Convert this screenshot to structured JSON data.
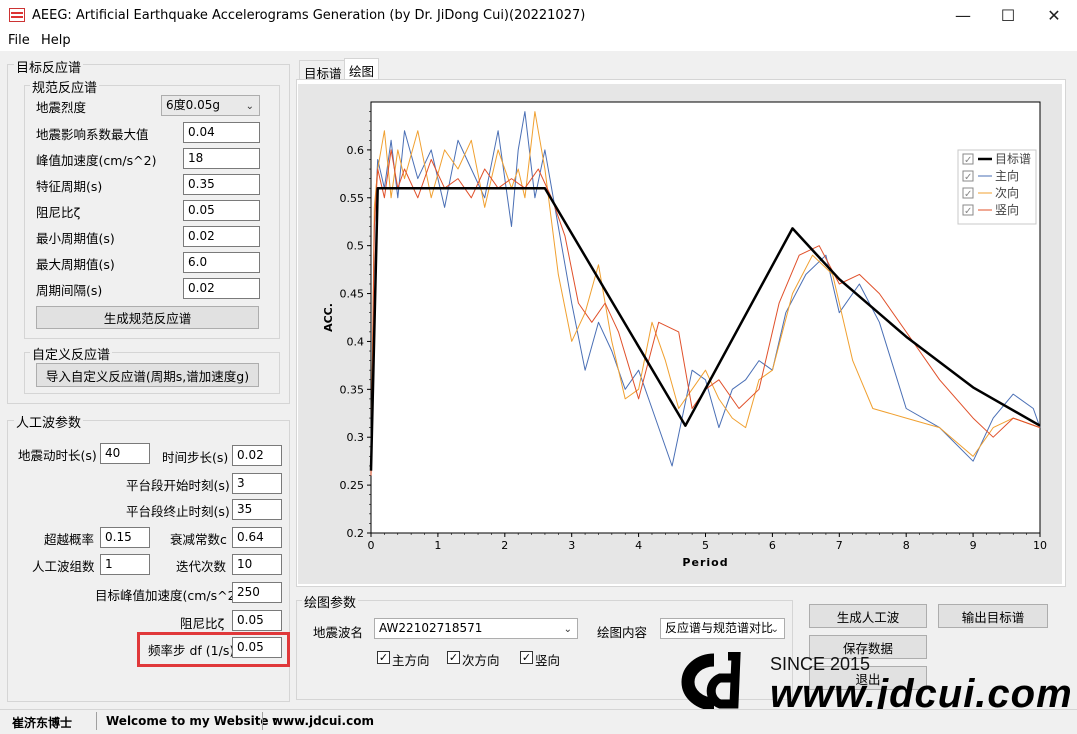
{
  "window": {
    "title": "AEEG: Artificial Earthquake Accelerograms Generation (by Dr. JiDong Cui)(20221027)",
    "minimize": "—",
    "maximize": "☐",
    "close": "✕"
  },
  "menu": {
    "file": "File",
    "help": "Help"
  },
  "target_spectrum": {
    "group_label": "目标反应谱",
    "code_group_label": "规范反应谱",
    "intensity_label": "地震烈度",
    "intensity_value": "6度0.05g",
    "alpha_max_label": "地震影响系数最大值",
    "alpha_max_value": "0.04",
    "pga_label": "峰值加速度(cm/s^2)",
    "pga_value": "18",
    "tg_label": "特征周期(s)",
    "tg_value": "0.35",
    "damping_label": "阻尼比ζ",
    "damping_value": "0.05",
    "tmin_label": "最小周期值(s)",
    "tmin_value": "0.02",
    "tmax_label": "最大周期值(s)",
    "tmax_value": "6.0",
    "tstep_label": "周期间隔(s)",
    "tstep_value": "0.02",
    "generate_button": "生成规范反应谱",
    "custom_group_label": "自定义反应谱",
    "import_button": "导入自定义反应谱(周期s,谱加速度g)"
  },
  "wave_params": {
    "group_label": "人工波参数",
    "duration_label": "地震动时长(s)",
    "duration_value": "40",
    "dt_label": "时间步长(s)",
    "dt_value": "0.02",
    "plateau_start_label": "平台段开始时刻(s)",
    "plateau_start_value": "3",
    "plateau_end_label": "平台段终止时刻(s)",
    "plateau_end_value": "35",
    "exceed_label": "超越概率",
    "exceed_value": "0.15",
    "decay_label": "衰减常数c",
    "decay_value": "0.64",
    "count_label": "人工波组数",
    "count_value": "1",
    "iter_label": "迭代次数",
    "iter_value": "10",
    "target_pga_label": "目标峰值加速度(cm/s^2)",
    "target_pga_value": "250",
    "damp_label": "阻尼比ζ",
    "damp_value": "0.05",
    "df_label": "频率步 df (1/s)",
    "df_value": "0.05",
    "highlight_color": "#e0383a"
  },
  "tabs": {
    "target": "目标谱",
    "plot": "绘图"
  },
  "plot_params": {
    "group_label": "绘图参数",
    "wave_name_label": "地震波名",
    "wave_name_value": "AW22102718571",
    "content_label": "绘图内容",
    "content_value": "反应谱与规范谱对比",
    "main_dir": "主方向",
    "second_dir": "次方向",
    "vertical_dir": "竖向"
  },
  "buttons": {
    "generate_wave": "生成人工波",
    "export_target": "输出目标谱",
    "save_data": "保存数据",
    "exit": "退出"
  },
  "status": {
    "author": "崔济东博士",
    "welcome": "Welcome to my Website :",
    "website": "www.jdcui.com"
  },
  "watermark": {
    "since": "SINCE 2015",
    "url": "www.jdcui.com"
  },
  "chart_data": {
    "type": "line",
    "xlabel": "Period",
    "ylabel": "ACC.",
    "xlim": [
      0,
      10
    ],
    "ylim": [
      0.2,
      0.65
    ],
    "xticks": [
      "0",
      "1",
      "2",
      "3",
      "4",
      "5",
      "6",
      "7",
      "8",
      "9",
      "10"
    ],
    "yticks": [
      "0.2",
      "0.25",
      "0.3",
      "0.35",
      "0.4",
      "0.45",
      "0.5",
      "0.55",
      "0.6"
    ],
    "legend_position": "top-right",
    "series": [
      {
        "name": "目标谱",
        "color": "#000000",
        "width": 2.5,
        "x": [
          0,
          0.1,
          0.1,
          2.6,
          4.7,
          6.3,
          7,
          8,
          9,
          10
        ],
        "y": [
          0.265,
          0.56,
          0.56,
          0.56,
          0.312,
          0.518,
          0.465,
          0.405,
          0.352,
          0.312
        ]
      },
      {
        "name": "主向",
        "color": "#4a6fb5",
        "width": 1,
        "x": [
          0,
          0.05,
          0.1,
          0.2,
          0.3,
          0.4,
          0.5,
          0.7,
          0.9,
          1.1,
          1.3,
          1.5,
          1.7,
          1.9,
          2.1,
          2.2,
          2.3,
          2.45,
          2.6,
          2.8,
          3.0,
          3.2,
          3.4,
          3.6,
          3.8,
          4.0,
          4.2,
          4.5,
          4.8,
          5.0,
          5.2,
          5.4,
          5.6,
          5.8,
          6.0,
          6.2,
          6.5,
          6.8,
          7.0,
          7.3,
          7.6,
          8.0,
          8.5,
          9.0,
          9.3,
          9.6,
          9.9,
          10
        ],
        "y": [
          0.26,
          0.52,
          0.59,
          0.56,
          0.61,
          0.55,
          0.62,
          0.57,
          0.6,
          0.54,
          0.61,
          0.58,
          0.55,
          0.62,
          0.52,
          0.6,
          0.64,
          0.55,
          0.6,
          0.52,
          0.44,
          0.37,
          0.42,
          0.39,
          0.35,
          0.37,
          0.33,
          0.27,
          0.37,
          0.36,
          0.31,
          0.35,
          0.36,
          0.38,
          0.37,
          0.43,
          0.47,
          0.49,
          0.43,
          0.46,
          0.42,
          0.33,
          0.31,
          0.275,
          0.32,
          0.345,
          0.33,
          0.31
        ]
      },
      {
        "name": "次向",
        "color": "#f0a030",
        "width": 1,
        "x": [
          0,
          0.05,
          0.1,
          0.2,
          0.3,
          0.4,
          0.5,
          0.7,
          0.9,
          1.1,
          1.3,
          1.5,
          1.7,
          1.9,
          2.1,
          2.2,
          2.3,
          2.45,
          2.6,
          2.8,
          3.0,
          3.2,
          3.4,
          3.6,
          3.8,
          4.0,
          4.2,
          4.4,
          4.6,
          4.8,
          5.0,
          5.2,
          5.4,
          5.6,
          5.8,
          6.0,
          6.3,
          6.6,
          6.9,
          7.2,
          7.5,
          8.0,
          8.5,
          9.0,
          9.3,
          9.6,
          10
        ],
        "y": [
          0.26,
          0.54,
          0.58,
          0.62,
          0.55,
          0.6,
          0.57,
          0.62,
          0.55,
          0.6,
          0.58,
          0.61,
          0.54,
          0.6,
          0.56,
          0.58,
          0.55,
          0.64,
          0.58,
          0.47,
          0.4,
          0.43,
          0.48,
          0.4,
          0.34,
          0.35,
          0.42,
          0.38,
          0.33,
          0.35,
          0.37,
          0.34,
          0.32,
          0.31,
          0.36,
          0.37,
          0.45,
          0.49,
          0.47,
          0.38,
          0.33,
          0.32,
          0.31,
          0.28,
          0.31,
          0.32,
          0.31
        ]
      },
      {
        "name": "竖向",
        "color": "#e0502a",
        "width": 1,
        "x": [
          0,
          0.05,
          0.1,
          0.2,
          0.3,
          0.4,
          0.5,
          0.7,
          0.9,
          1.1,
          1.3,
          1.5,
          1.7,
          1.9,
          2.1,
          2.3,
          2.5,
          2.7,
          2.9,
          3.1,
          3.3,
          3.5,
          3.7,
          4.0,
          4.3,
          4.6,
          4.8,
          5.0,
          5.2,
          5.5,
          5.8,
          6.1,
          6.4,
          6.7,
          7.0,
          7.3,
          7.6,
          8.0,
          8.5,
          9.0,
          9.3,
          9.6,
          10
        ],
        "y": [
          0.26,
          0.52,
          0.58,
          0.55,
          0.6,
          0.56,
          0.58,
          0.55,
          0.59,
          0.56,
          0.57,
          0.55,
          0.58,
          0.56,
          0.57,
          0.56,
          0.58,
          0.55,
          0.51,
          0.44,
          0.42,
          0.44,
          0.41,
          0.34,
          0.42,
          0.41,
          0.33,
          0.35,
          0.36,
          0.33,
          0.35,
          0.44,
          0.49,
          0.5,
          0.46,
          0.47,
          0.45,
          0.41,
          0.36,
          0.32,
          0.3,
          0.32,
          0.31
        ]
      }
    ]
  }
}
